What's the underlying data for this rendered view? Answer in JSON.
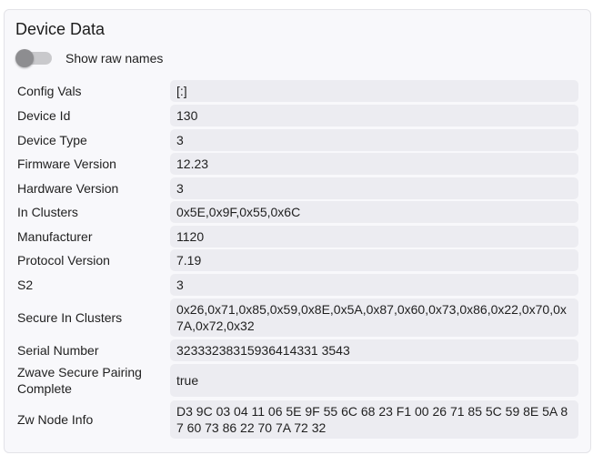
{
  "panel": {
    "title": "Device Data",
    "toggle_label": "Show raw names",
    "toggle_on": false
  },
  "rows": [
    {
      "label": "Config Vals",
      "value": "[:]"
    },
    {
      "label": "Device Id",
      "value": "130"
    },
    {
      "label": "Device Type",
      "value": "3"
    },
    {
      "label": "Firmware Version",
      "value": "12.23"
    },
    {
      "label": "Hardware Version",
      "value": "3"
    },
    {
      "label": "In Clusters",
      "value": "0x5E,0x9F,0x55,0x6C"
    },
    {
      "label": "Manufacturer",
      "value": "1120"
    },
    {
      "label": "Protocol Version",
      "value": "7.19"
    },
    {
      "label": "S2",
      "value": "3"
    },
    {
      "label": "Secure In Clusters",
      "value": "0x26,0x71,0x85,0x59,0x8E,0x5A,0x87,0x60,0x73,0x86,0x22,0x70,0x7A,0x72,0x32"
    },
    {
      "label": "Serial Number",
      "value": "32333238315936414331 3543"
    },
    {
      "label": "Zwave Secure Pairing Complete",
      "value": "true"
    },
    {
      "label": "Zw Node Info",
      "value": "D3 9C 03 04 11 06 5E 9F 55 6C 68 23 F1 00 26 71 85 5C 59 8E 5A 87 60 73 86 22 70 7A 72 32"
    }
  ]
}
